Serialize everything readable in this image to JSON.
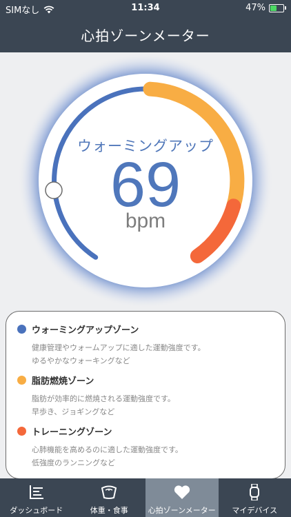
{
  "status": {
    "carrier": "SIMなし",
    "time": "11:34",
    "battery": "47%",
    "battery_level": 0.47
  },
  "nav": {
    "title": "心拍ゾーンメーター"
  },
  "gauge": {
    "zone_label": "ウォーミングアップ",
    "value": "69",
    "unit": "bpm",
    "colors": {
      "warmup": "#4a72bc",
      "fatburn": "#f8ad44",
      "training": "#f4683a"
    }
  },
  "zones": [
    {
      "name": "ウォーミングアップゾーン",
      "color": "#4a72bc",
      "desc1": "健康管理やウォームアップに適した運動強度です。",
      "desc2": "ゆるやかなウォーキングなど"
    },
    {
      "name": "脂肪燃焼ゾーン",
      "color": "#f8ad44",
      "desc1": "脂肪が効率的に燃焼される運動強度です。",
      "desc2": "早歩き、ジョギングなど"
    },
    {
      "name": "トレーニングゾーン",
      "color": "#f4683a",
      "desc1": "心肺機能を高めるのに適した運動強度です。",
      "desc2": "低強度のランニングなど"
    }
  ],
  "tabs": [
    {
      "label": "ダッシュボード",
      "icon": "dashboard-icon"
    },
    {
      "label": "体重・食事",
      "icon": "scale-icon"
    },
    {
      "label": "心拍ゾーンメーター",
      "icon": "heart-icon"
    },
    {
      "label": "マイデバイス",
      "icon": "watch-icon"
    }
  ]
}
